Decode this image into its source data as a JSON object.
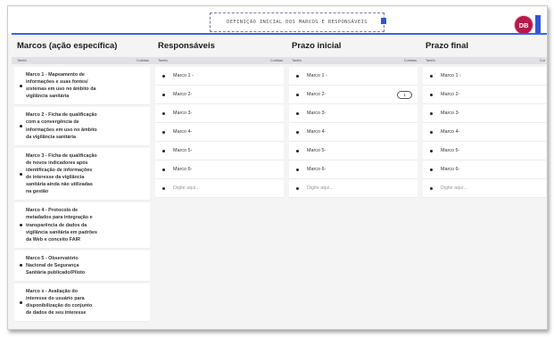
{
  "header": {
    "title": "DEFINIÇÃO INICIAL DOS MARCOS E RESPONSÁVEIS",
    "avatar_initials": "DB"
  },
  "colors": {
    "accent": "#3a63e0",
    "avatar_bg": "#b8184c",
    "card_bg": "#ffffff",
    "board_bg": "#f4f4f5"
  },
  "columns": [
    {
      "title": "Marcos (ação específica)",
      "sub_left": "Tarefa",
      "sub_right": "Curtidas",
      "cards": [
        {
          "lines": [
            "Marco 1 - Mapeamento de",
            "informações e suas fontes/",
            "sistemas em uso no âmbito da",
            "vigilância sanitária"
          ]
        },
        {
          "lines": [
            "Marco 2 - Ficha de qualificação",
            "com a convergência de",
            "informações em uso no âmbito",
            "da vigilância sanitária"
          ]
        },
        {
          "lines": [
            "Marco 3 - Ficha de qualificação",
            "de novos indicadores após",
            "identificação de informações",
            "de interesse da vigilância",
            "sanitária ainda não utilizadas",
            "na gestão"
          ]
        },
        {
          "lines": [
            "Marco 4 - Protocolo de",
            "metadados para integração e",
            "transparência de dados da",
            "vigilância sanitária em padrões",
            "da Web e conceito FAIR"
          ]
        },
        {
          "lines": [
            "Marco 5 - Observatório",
            "Nacional de Segurança",
            "Sanitária publicado/Piloto"
          ]
        },
        {
          "lines": [
            "Marco x - Avaliação do",
            "interesse do usuário para",
            "disponibilização do conjunto",
            "de dados de seu interesse"
          ]
        }
      ]
    },
    {
      "title": "Responsáveis",
      "sub_left": "Tarefa",
      "sub_right": "Curtidas",
      "cards": [
        "Marco 1 -",
        "Marco 2-",
        "Marco 3-",
        "Marco 4-",
        "Marco 5-",
        "Marco 6-"
      ],
      "placeholder": "Digite aqui..."
    },
    {
      "title": "Prazo inicial",
      "sub_left": "Tarefa",
      "sub_right": "Curtidas",
      "cards": [
        "Marco 1 -",
        "Marco 2-",
        "Marco 3-",
        "Marco 4-",
        "Marco 5-",
        "Marco 6-"
      ],
      "badge": "1",
      "placeholder": "Digite aqui..."
    },
    {
      "title": "Prazo final",
      "sub_left": "Tarefa",
      "sub_right": "Cur",
      "cards": [
        "Marco 1 -",
        "Marco 2-",
        "Marco 3-",
        "Marco 4-",
        "Marco 5-",
        "Marco 6-"
      ],
      "placeholder": "Digite aqui..."
    }
  ]
}
